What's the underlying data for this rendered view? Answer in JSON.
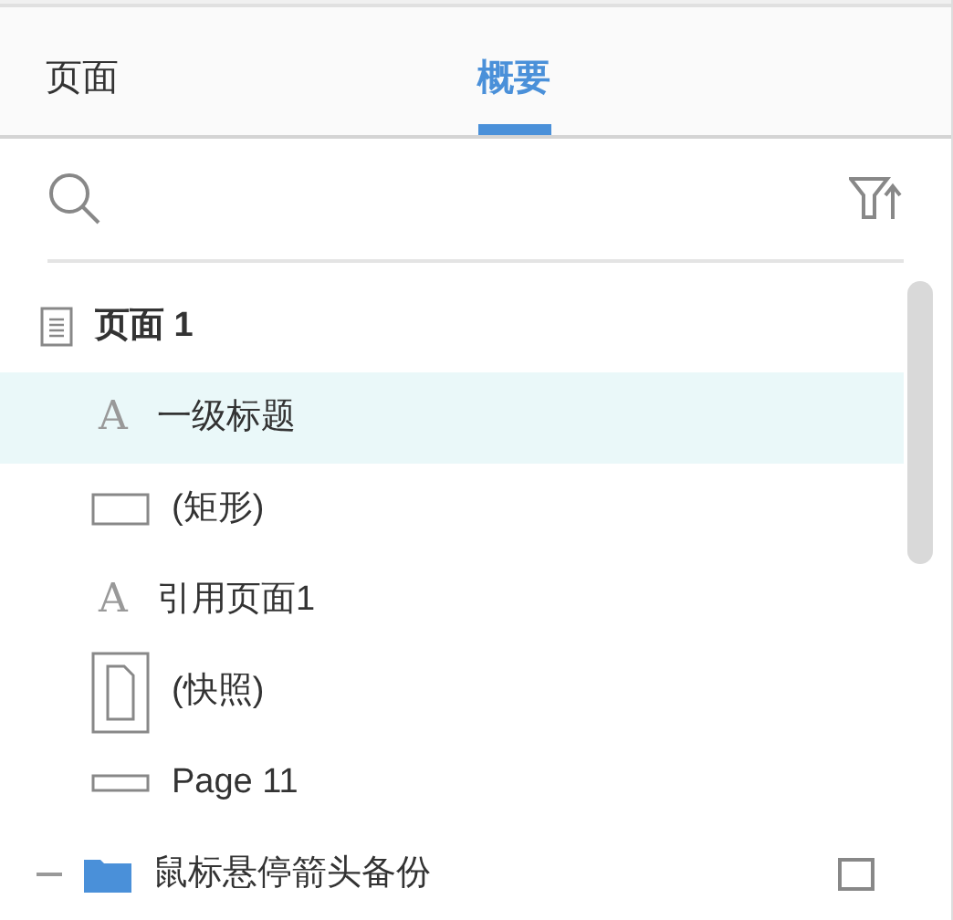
{
  "tabs": [
    {
      "label": "页面",
      "selected": false
    },
    {
      "label": "概要",
      "selected": true
    }
  ],
  "outline": [
    {
      "kind": "page",
      "label": "页面 1",
      "selected": false,
      "children": [
        {
          "kind": "text",
          "icon": "A",
          "label": "一级标题",
          "selected": true
        },
        {
          "kind": "rectangle",
          "label": "(矩形)",
          "selected": false
        },
        {
          "kind": "text",
          "icon": "A",
          "label": "引用页面1",
          "selected": false
        },
        {
          "kind": "snapshot",
          "label": "(快照)",
          "selected": false
        },
        {
          "kind": "placeholder",
          "label": "Page 11",
          "selected": false
        }
      ]
    },
    {
      "kind": "folder",
      "label": "鼠标悬停箭头备份",
      "selected": false
    }
  ]
}
